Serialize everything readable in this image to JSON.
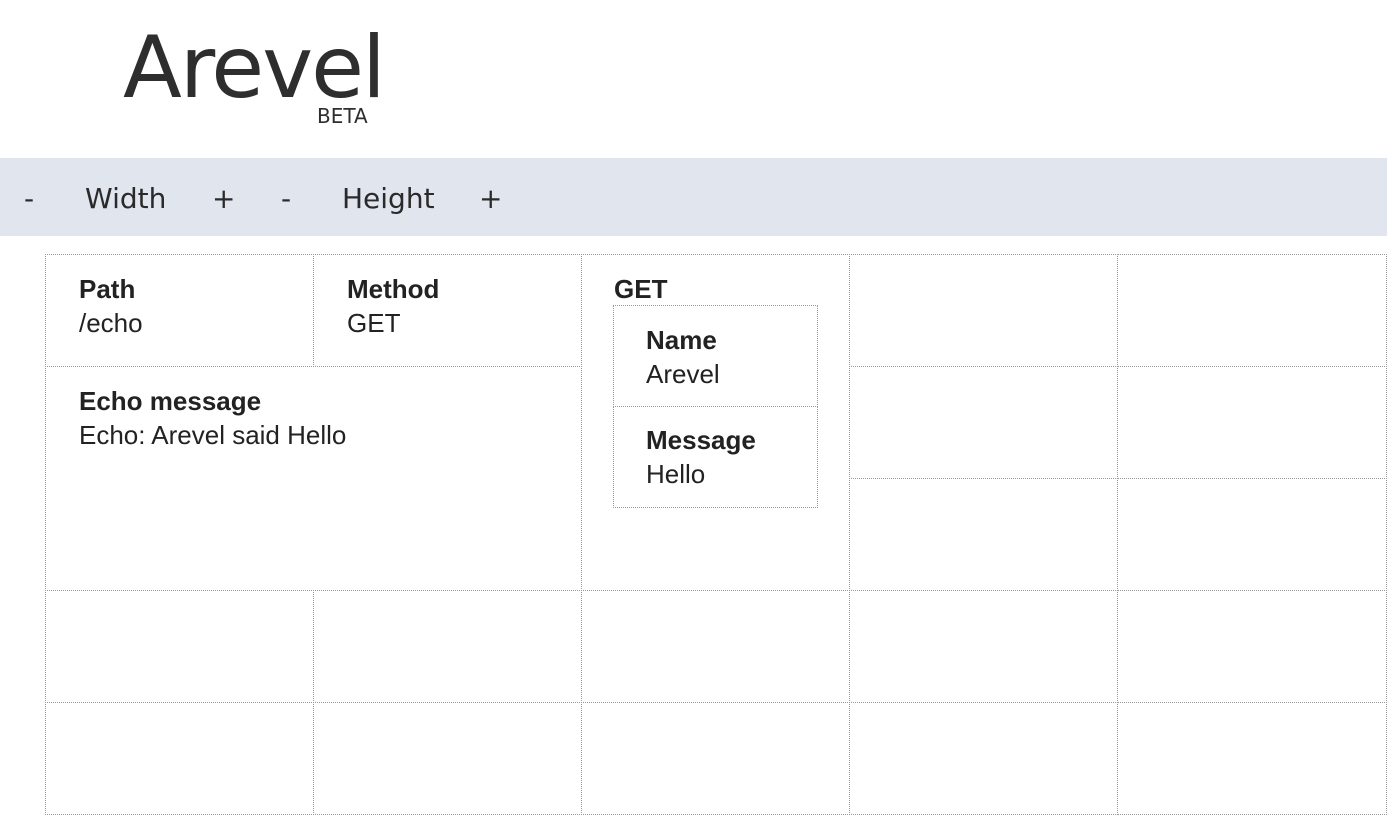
{
  "logo": {
    "word": "Arevel",
    "badge": "BETA"
  },
  "toolbar": {
    "width_minus": "-",
    "width_label": "Width",
    "width_plus": "+",
    "height_minus": "-",
    "height_label": "Height",
    "height_plus": "+"
  },
  "cells": {
    "path": {
      "label": "Path",
      "value": "/echo"
    },
    "method": {
      "label": "Method",
      "value": "GET"
    },
    "echo": {
      "label": "Echo message",
      "value": "Echo: Arevel said Hello"
    },
    "get": {
      "title": "GET",
      "name": {
        "label": "Name",
        "value": "Arevel"
      },
      "message": {
        "label": "Message",
        "value": "Hello"
      }
    }
  }
}
